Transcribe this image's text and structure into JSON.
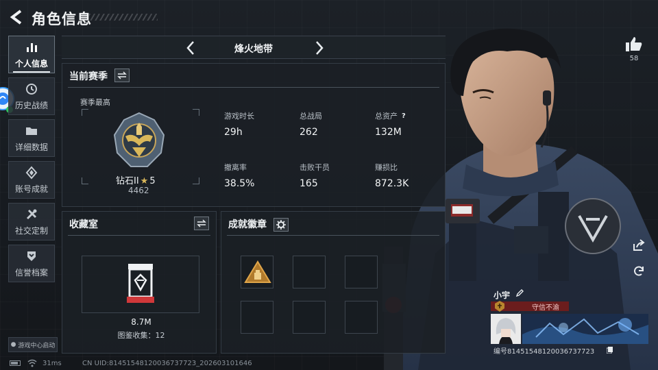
{
  "header": {
    "title": "角色信息"
  },
  "sidebar": {
    "items": [
      {
        "label": "个人信息",
        "icon": "bar-chart-icon",
        "active": true
      },
      {
        "label": "历史战绩",
        "icon": "clock-icon",
        "active": false
      },
      {
        "label": "详细数据",
        "icon": "folder-icon",
        "active": false
      },
      {
        "label": "账号成就",
        "icon": "diamond-badge-icon",
        "active": false
      },
      {
        "label": "社交定制",
        "icon": "tools-icon",
        "active": false
      },
      {
        "label": "信誉档案",
        "icon": "shield-chevron-icon",
        "active": false
      }
    ],
    "game_center": "游戏中心启动"
  },
  "mode": {
    "label": "烽火地带"
  },
  "season": {
    "title": "当前赛季",
    "best_label": "赛季最高",
    "rank_name": "钻石II",
    "rank_stars": "5",
    "rank_points": "4462",
    "stats": [
      {
        "label": "游戏时长",
        "value": "29h"
      },
      {
        "label": "总战局",
        "value": "262"
      },
      {
        "label": "总资产",
        "value": "132M",
        "help": "?"
      },
      {
        "label": "撤离率",
        "value": "38.5%"
      },
      {
        "label": "击败干员",
        "value": "165"
      },
      {
        "label": "赚损比",
        "value": "872.3K"
      }
    ]
  },
  "collection": {
    "title": "收藏室",
    "value": "8.7M",
    "count_label": "图鉴收集：12"
  },
  "achievements": {
    "title": "成就徽章"
  },
  "likes": {
    "count": "58"
  },
  "player": {
    "name": "小宇",
    "title": "守信不渝",
    "id": "编号8145154812003673772​3"
  },
  "status": {
    "ping": "31ms",
    "uid": "CN UID:81451548120036737723_202603101646"
  },
  "colors": {
    "background": "#1a1e23",
    "panel": "#1b2026",
    "title_plate": "#6b1d1d",
    "rank_gold": "#d9b75a"
  }
}
